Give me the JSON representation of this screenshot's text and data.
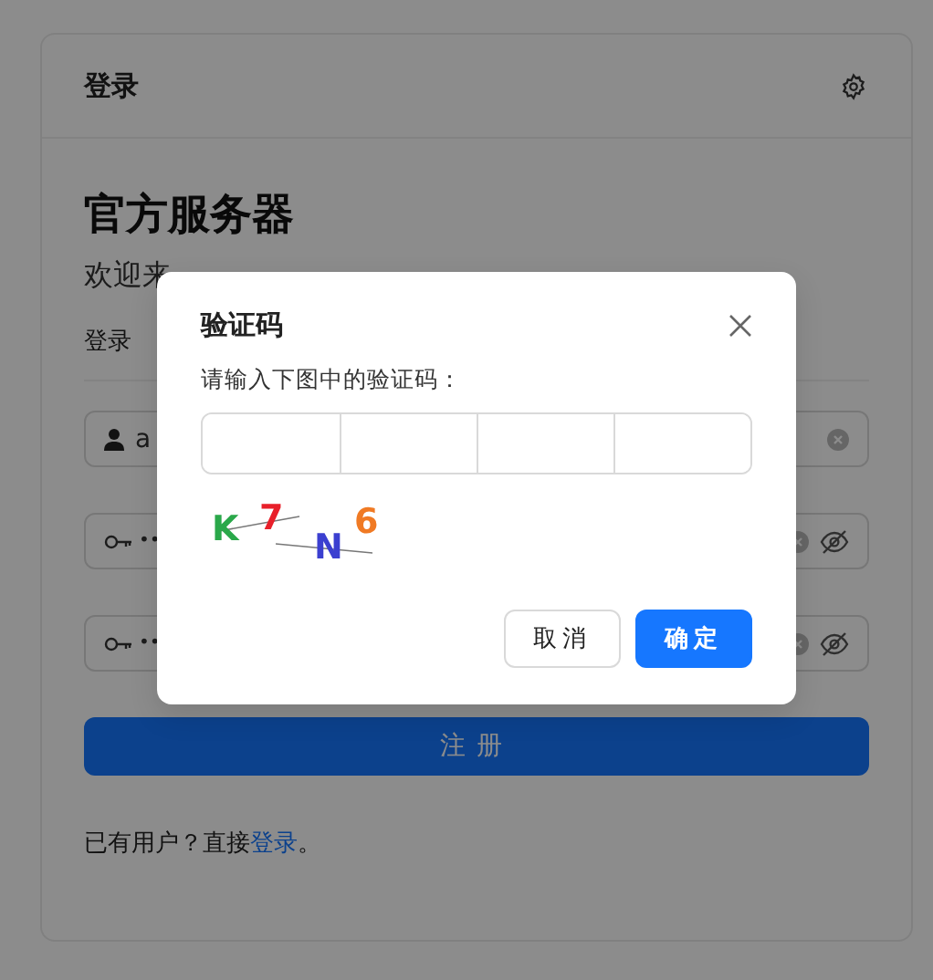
{
  "page": {
    "header": {
      "title": "登录"
    },
    "heading": "官方服务器",
    "welcome": "欢迎来",
    "section_label": "登录",
    "fields": [
      {
        "kind": "username",
        "value": "a"
      },
      {
        "kind": "password",
        "value": "••"
      },
      {
        "kind": "password",
        "value": "••"
      }
    ],
    "submit": "注册",
    "footer": {
      "text": "已有用户？直接",
      "link": "登录",
      "end": "。"
    }
  },
  "dialog": {
    "title": "验证码",
    "prompt": "请输入下图中的验证码：",
    "code_inputs": [
      {
        "filled": false
      },
      {
        "filled": false
      },
      {
        "filled": false
      },
      {
        "filled": false
      }
    ],
    "captcha": [
      {
        "char": "K",
        "color": "#2aa84a"
      },
      {
        "char": "7",
        "color": "#e8202a"
      },
      {
        "char": "N",
        "color": "#3b3fd0"
      },
      {
        "char": "6",
        "color": "#f07a24"
      }
    ],
    "buttons": [
      {
        "kind": "secondary",
        "label": "取消"
      },
      {
        "kind": "primary",
        "label": "确定"
      }
    ]
  }
}
